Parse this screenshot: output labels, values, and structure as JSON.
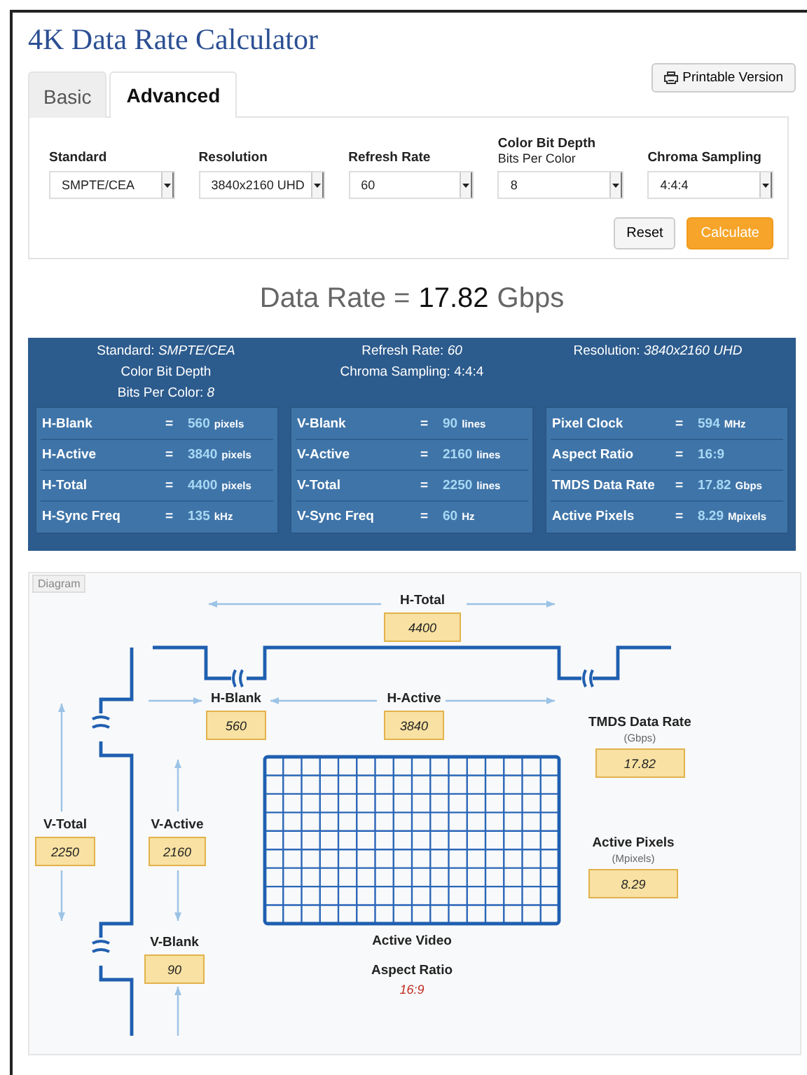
{
  "title": "4K Data Rate Calculator",
  "tabs": [
    {
      "label": "Basic",
      "selected": false
    },
    {
      "label": "Advanced",
      "selected": true
    }
  ],
  "print_button": "Printable Version",
  "fields": [
    {
      "label": "Standard",
      "value": "SMPTE/CEA"
    },
    {
      "label": "Resolution",
      "value": "3840x2160 UHD"
    },
    {
      "label": "Refresh Rate",
      "value": "60"
    },
    {
      "label": "Color Bit Depth",
      "sublabel": "Bits Per Color",
      "value": "8"
    },
    {
      "label": "Chroma Sampling",
      "value": "4:4:4"
    }
  ],
  "buttons": [
    {
      "label": "Reset",
      "kind": "default"
    },
    {
      "label": "Calculate",
      "kind": "primary"
    }
  ],
  "data_rate": {
    "label": "Data Rate =",
    "value": "17.82",
    "unit": "Gbps"
  },
  "summary": [
    [
      "Standard: *SMPTE/CEA*",
      "Color Bit Depth",
      "Bits Per Color: *8*"
    ],
    [
      "Refresh Rate: *60*",
      "Chroma Sampling: 4:4:4"
    ],
    [
      "Resolution: *3840x2160 UHD*"
    ]
  ],
  "tables": [
    [
      {
        "label": "H-Blank",
        "eq": "=",
        "value": "560",
        "unit": "pixels"
      },
      {
        "label": "H-Active",
        "eq": "=",
        "value": "3840",
        "unit": "pixels"
      },
      {
        "label": "H-Total",
        "eq": "=",
        "value": "4400",
        "unit": "pixels"
      },
      {
        "label": "H-Sync Freq",
        "eq": "=",
        "value": "135",
        "unit": "kHz"
      }
    ],
    [
      {
        "label": "V-Blank",
        "eq": "=",
        "value": "90",
        "unit": "lines"
      },
      {
        "label": "V-Active",
        "eq": "=",
        "value": "2160",
        "unit": "lines"
      },
      {
        "label": "V-Total",
        "eq": "=",
        "value": "2250",
        "unit": "lines"
      },
      {
        "label": "V-Sync Freq",
        "eq": "=",
        "value": "60",
        "unit": "Hz"
      }
    ],
    [
      {
        "label": "Pixel Clock",
        "eq": "=",
        "value": "594",
        "unit": "MHz"
      },
      {
        "label": "Aspect Ratio",
        "eq": "=",
        "value": "16:9"
      },
      {
        "label": "TMDS Data Rate",
        "eq": "=",
        "value": "17.82",
        "unit": "Gbps"
      },
      {
        "label": "Active Pixels",
        "eq": "=",
        "value": "8.29",
        "unit": "Mpixels"
      }
    ]
  ],
  "diagram": {
    "title": "Diagram",
    "measures": [
      {
        "kind": "h_total",
        "label": "H-Total",
        "value": "4400"
      },
      {
        "kind": "h_blank",
        "label": "H-Blank",
        "value": "560"
      },
      {
        "kind": "h_active",
        "label": "H-Active",
        "value": "3840"
      },
      {
        "kind": "v_total",
        "label": "V-Total",
        "value": "2250"
      },
      {
        "kind": "v_active",
        "label": "V-Active",
        "value": "2160"
      },
      {
        "kind": "v_blank",
        "label": "V-Blank",
        "value": "90"
      },
      {
        "kind": "tmds",
        "label": "TMDS Data Rate",
        "unit": "(Gbps)",
        "value": "17.82"
      },
      {
        "kind": "pixels",
        "label": "Active Pixels",
        "unit": "(Mpixels)",
        "value": "8.29"
      }
    ],
    "video_label": "Active Video",
    "aspect": {
      "label": "Aspect Ratio",
      "value": "16:9"
    }
  }
}
